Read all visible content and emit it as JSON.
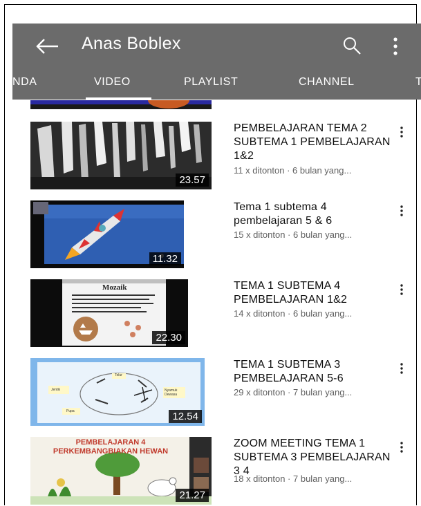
{
  "header": {
    "title": "Anas Boblex"
  },
  "tabs": [
    {
      "label": "NDA"
    },
    {
      "label": "VIDEO"
    },
    {
      "label": "PLAYLIST"
    },
    {
      "label": "CHANNEL"
    },
    {
      "label": "T"
    }
  ],
  "active_tab": "VIDEO",
  "videos": [
    {
      "title": "PEMBELAJARAN TEMA 2 SUBTEMA 1 PEMBELAJARAN 1&2",
      "meta": "11 x ditonton · 6 bulan yang...",
      "duration": "23.57"
    },
    {
      "title": "Tema 1 subtema 4 pembelajaran 5 & 6",
      "meta": "15 x ditonton · 6 bulan yang...",
      "duration": "11.32"
    },
    {
      "title": "TEMA 1 SUBTEMA 4 PEMBELAJARAN 1&2",
      "meta": "14 x ditonton · 6 bulan yang...",
      "duration": "22.30",
      "slide_heading": "Mozaik"
    },
    {
      "title": "TEMA 1 SUBTEMA 3 PEMBELAJARAN 5-6",
      "meta": "29 x ditonton · 7 bulan yang...",
      "duration": "12.54",
      "diagram_labels": [
        "Telur",
        "Jentik",
        "Nyamuk Dewasa",
        "Pupa"
      ]
    },
    {
      "title": "ZOOM MEETING TEMA 1 SUBTEMA 3 PEMBELAJARAN 3 4",
      "meta": "18 x ditonton · 7 bulan yang...",
      "duration": "21.27",
      "banner_text": "PEMBELAJARAN 4 PERKEMBANGBIAKAN HEWAN"
    }
  ],
  "colors": {
    "appbar": "#6b6b6b",
    "text": "#0f0f0f",
    "meta": "#606060"
  }
}
